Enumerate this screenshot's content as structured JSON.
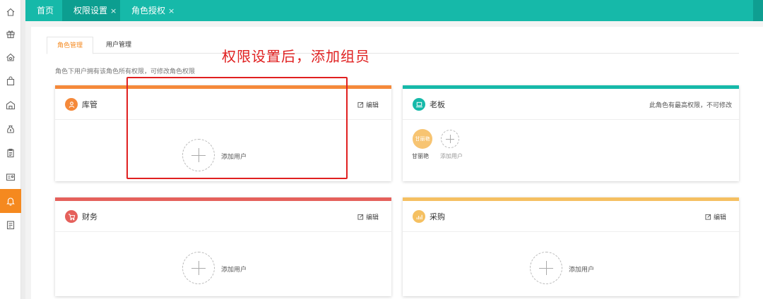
{
  "sidebar": {
    "items": [
      {
        "icon": "home-icon"
      },
      {
        "icon": "gift-icon"
      },
      {
        "icon": "house-gear-icon"
      },
      {
        "icon": "shopping-bag-icon"
      },
      {
        "icon": "warehouse-icon"
      },
      {
        "icon": "money-bag-icon"
      },
      {
        "icon": "clipboard-icon"
      },
      {
        "icon": "id-card-icon"
      },
      {
        "icon": "bell-icon",
        "active": true
      },
      {
        "icon": "report-icon"
      }
    ],
    "active_color": "#f5891f"
  },
  "topbar": {
    "color": "#16b9a9",
    "tabs": [
      {
        "label": "首页",
        "closable": false
      },
      {
        "label": "权限设置",
        "closable": true,
        "active": true
      },
      {
        "label": "角色授权",
        "closable": true
      }
    ],
    "close_glyph": "×"
  },
  "subtabs": [
    {
      "label": "角色管理",
      "active": true
    },
    {
      "label": "用户管理"
    }
  ],
  "hint": "角色下用户拥有该角色所有权限，可修改角色权限",
  "annotation": {
    "text": "权限设置后，添加组员",
    "color": "#e02020"
  },
  "cards": [
    {
      "name": "库管",
      "color": "#f5893a",
      "edit_label": "编辑",
      "add_label": "添加用户",
      "icon": "user-icon"
    },
    {
      "name": "老板",
      "color": "#16b9a9",
      "note": "此角色有最高权限，不可修改",
      "icon": "laptop-icon",
      "members": [
        {
          "avatar_text": "甘丽艳",
          "name": "甘丽艳"
        }
      ],
      "add_label": "添加用户"
    },
    {
      "name": "财务",
      "color": "#e5605b",
      "edit_label": "编辑",
      "add_label": "添加用户",
      "icon": "cart-icon"
    },
    {
      "name": "采购",
      "color": "#f5c061",
      "edit_label": "编辑",
      "add_label": "添加用户",
      "icon": "chart-icon"
    }
  ]
}
